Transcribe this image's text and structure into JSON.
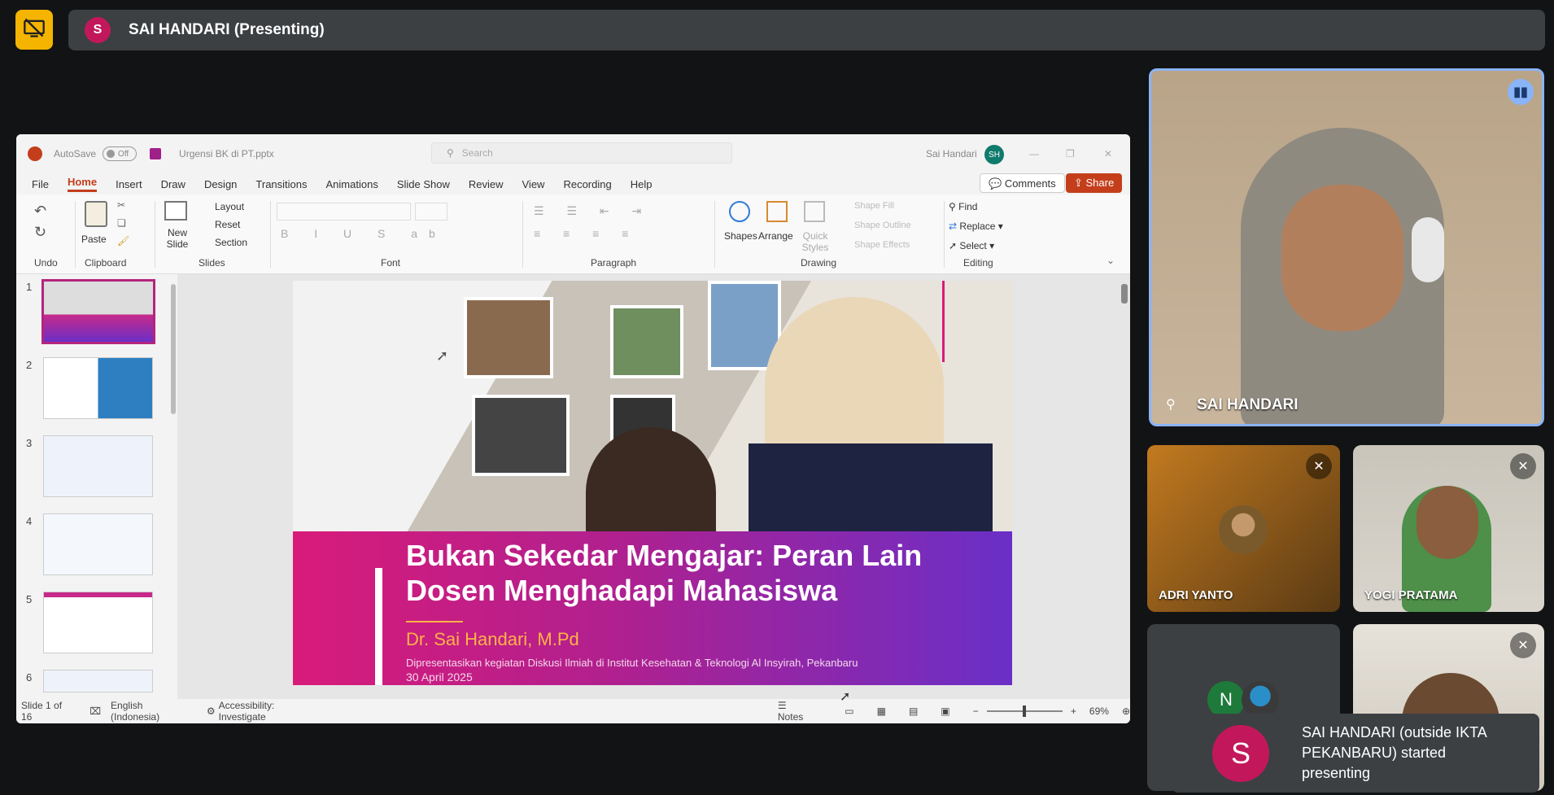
{
  "topbar": {
    "avatar_letter": "S",
    "title": "SAI HANDARI (Presenting)"
  },
  "ppt": {
    "autosave_label": "AutoSave",
    "autosave_state": "Off",
    "filename": "Urgensi BK di PT.pptx",
    "search_placeholder": "Search",
    "user_name": "Sai Handari",
    "user_initials": "SH",
    "menu": [
      "File",
      "Home",
      "Insert",
      "Draw",
      "Design",
      "Transitions",
      "Animations",
      "Slide Show",
      "Review",
      "View",
      "Recording",
      "Help"
    ],
    "comments": "Comments",
    "share": "Share",
    "ribbon": {
      "undo": "Undo",
      "paste": "Paste",
      "clipboard": "Clipboard",
      "new_slide": "New Slide",
      "layout": "Layout",
      "reset": "Reset",
      "section": "Section",
      "slides": "Slides",
      "font": "Font",
      "paragraph": "Paragraph",
      "shapes": "Shapes",
      "arrange": "Arrange",
      "quick_styles": "Quick Styles",
      "shape_fill": "Shape Fill",
      "shape_outline": "Shape Outline",
      "shape_effects": "Shape Effects",
      "drawing": "Drawing",
      "find": "Find",
      "replace": "Replace",
      "select": "Select",
      "editing": "Editing"
    },
    "thumbs": [
      "1",
      "2",
      "3",
      "4",
      "5",
      "6"
    ],
    "slide": {
      "title": "Bukan Sekedar Mengajar: Peran Lain Dosen Menghadapi Mahasiswa",
      "author": "Dr. Sai Handari, M.Pd",
      "event": "Dipresentasikan kegiatan Diskusi Ilmiah di Institut Kesehatan & Teknologi Al Insyirah, Pekanbaru",
      "date": "30 April 2025"
    },
    "status": {
      "slide_of": "Slide 1 of 16",
      "language": "English (Indonesia)",
      "accessibility": "Accessibility: Investigate",
      "notes": "Notes",
      "zoom": "69%"
    }
  },
  "participants": [
    {
      "name": "SAI HANDARI",
      "speaking": true
    },
    {
      "name": "ADRI YANTO",
      "muted": true
    },
    {
      "name": "YOGI PRATAMA",
      "muted": true
    },
    {
      "name": "",
      "muted": false,
      "avatar_letter": "N"
    },
    {
      "name": "",
      "muted": true
    }
  ],
  "toast": {
    "avatar_letter": "S",
    "message": "SAI HANDARI (outside IKTA PEKANBARU) started presenting"
  },
  "colors": {
    "accent": "#c43e1c",
    "presenter": "#c2185b",
    "meet_yellow": "#f4b400",
    "slide_pink": "#d81b7a",
    "slide_purple": "#6a2fc7",
    "slide_orange": "#ffb347"
  }
}
